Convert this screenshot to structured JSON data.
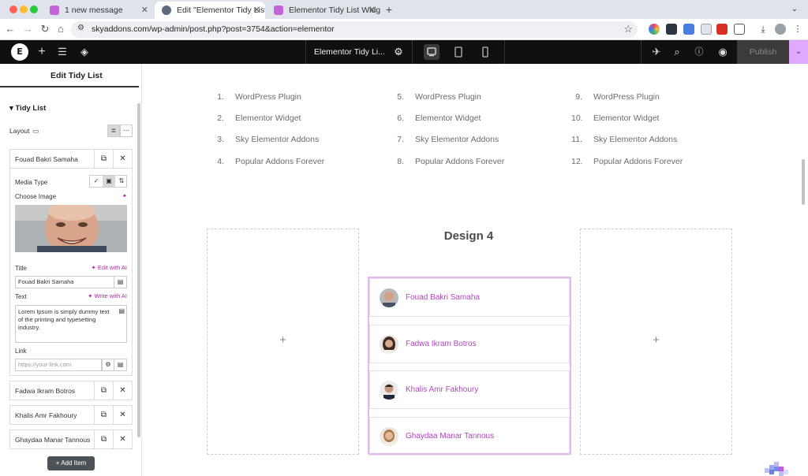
{
  "browser": {
    "tabs": [
      {
        "title": "1 new message",
        "active": false
      },
      {
        "title": "Edit \"Elementor Tidy List Wid",
        "active": true
      },
      {
        "title": "Elementor Tidy List Widget -",
        "active": false
      }
    ],
    "url": "skyaddons.com/wp-admin/post.php?post=3754&action=elementor"
  },
  "editor": {
    "document_title": "Elementor Tidy Li...",
    "publish_label": "Publish"
  },
  "panel": {
    "header": "Edit Tidy List",
    "section_title": "Tidy List",
    "layout_label": "Layout",
    "open_item": {
      "name": "Fouad Bakri Samaha",
      "media_type_label": "Media Type",
      "choose_image_label": "Choose Image",
      "title_label": "Title",
      "edit_ai_label": "Edit with AI",
      "title_value": "Fouad Bakri Samaha",
      "text_label": "Text",
      "write_ai_label": "Write with AI",
      "text_value": "Lorem Ipsum is simply dummy text of the printing and typesetting industry.",
      "link_label": "Link",
      "link_placeholder": "https://your-link.com"
    },
    "collapsed_items": [
      "Fadwa Ikram Botros",
      "Khalis Amr Fakhoury",
      "Ghaydaa Manar Tannous"
    ],
    "add_item_label": "Add Item"
  },
  "canvas": {
    "list_columns": [
      [
        {
          "num": "1.",
          "text": "WordPress Plugin"
        },
        {
          "num": "2.",
          "text": "Elementor Widget"
        },
        {
          "num": "3.",
          "text": "Sky Elementor Addons"
        },
        {
          "num": "4.",
          "text": "Popular Addons Forever"
        }
      ],
      [
        {
          "num": "5.",
          "text": "WordPress Plugin"
        },
        {
          "num": "6.",
          "text": "Elementor Widget"
        },
        {
          "num": "7.",
          "text": "Sky Elementor Addons"
        },
        {
          "num": "8.",
          "text": "Popular Addons Forever"
        }
      ],
      [
        {
          "num": "9.",
          "text": "WordPress Plugin"
        },
        {
          "num": "10.",
          "text": "Elementor Widget"
        },
        {
          "num": "11.",
          "text": "Sky Elementor Addons"
        },
        {
          "num": "12.",
          "text": "Popular Addons Forever"
        }
      ]
    ],
    "design_title": "Design 4",
    "people": [
      "Fouad Bakri Samaha",
      "Fadwa Ikram Botros",
      "Khalis Amr Fakhoury",
      "Ghaydaa Manar Tannous"
    ]
  },
  "colors": {
    "accent": "#b246c0",
    "selection_border": "#e6b6f2",
    "editor_bar": "#101010",
    "publish_more": "#e0a8ff"
  }
}
